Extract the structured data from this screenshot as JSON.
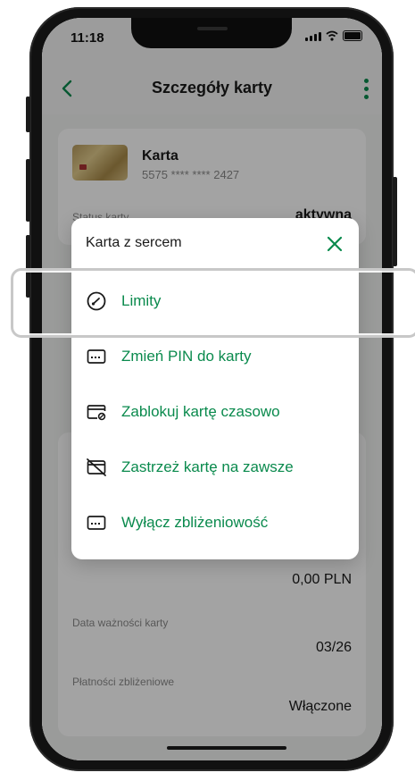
{
  "status_bar": {
    "time": "11:18"
  },
  "header": {
    "title": "Szczegóły karty"
  },
  "card": {
    "name": "Karta",
    "number": "5575 **** **** 2427",
    "status_label": "Status karty",
    "status_value": "aktywna"
  },
  "info": {
    "limit_value": "0,00 PLN",
    "expiry_label": "Data ważności karty",
    "expiry_value": "03/26",
    "contactless_label": "Płatności zbliżeniowe",
    "contactless_value": "Włączone"
  },
  "modal": {
    "title": "Karta z sercem",
    "items": [
      {
        "label": "Limity",
        "icon": "speedometer-icon"
      },
      {
        "label": "Zmień PIN do karty",
        "icon": "pin-card-icon"
      },
      {
        "label": "Zablokuj kartę czasowo",
        "icon": "card-lock-icon"
      },
      {
        "label": "Zastrzeż kartę na zawsze",
        "icon": "card-cancel-icon"
      },
      {
        "label": "Wyłącz zbliżeniowość",
        "icon": "contactless-card-icon"
      }
    ]
  },
  "colors": {
    "accent": "#0a8a4d",
    "overlay": "rgba(0,0,0,0.36)"
  }
}
